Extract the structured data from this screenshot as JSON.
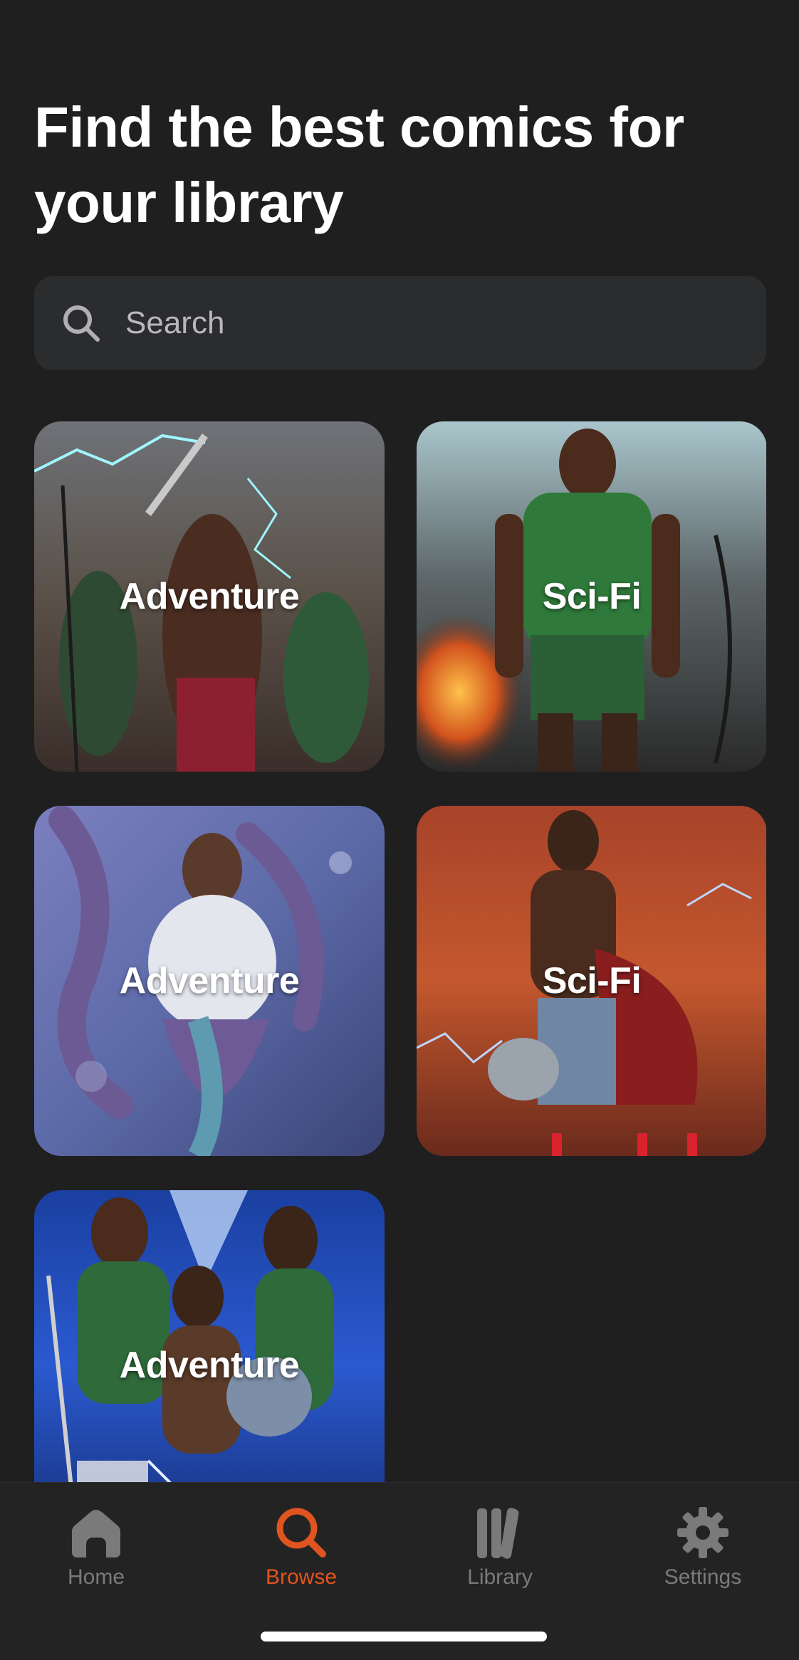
{
  "header": {
    "title": "Find the best comics for your library"
  },
  "search": {
    "placeholder": "Search",
    "value": ""
  },
  "categories": [
    {
      "label": "Adventure"
    },
    {
      "label": "Sci-Fi"
    },
    {
      "label": "Adventure"
    },
    {
      "label": "Sci-Fi"
    },
    {
      "label": "Adventure"
    }
  ],
  "tabbar": {
    "active": "Browse",
    "accent_color": "#e0541f",
    "items": [
      {
        "label": "Home",
        "icon": "home-icon"
      },
      {
        "label": "Browse",
        "icon": "search-icon"
      },
      {
        "label": "Library",
        "icon": "library-icon"
      },
      {
        "label": "Settings",
        "icon": "gear-icon"
      }
    ]
  }
}
